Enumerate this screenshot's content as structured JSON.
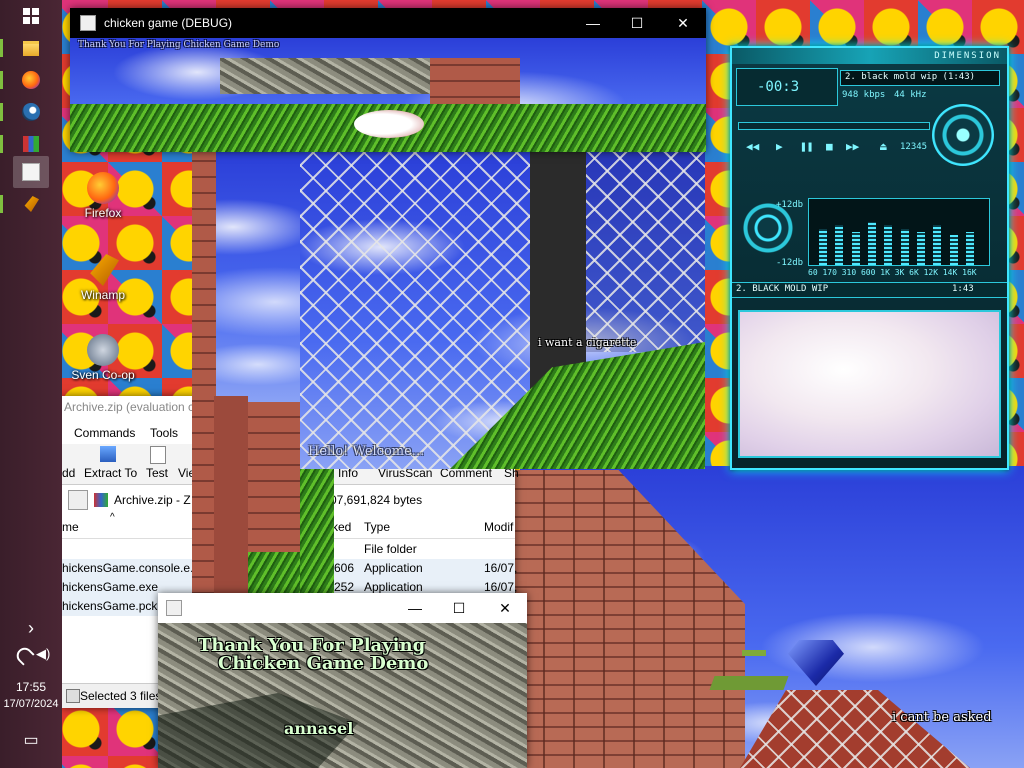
{
  "taskbar": {
    "clock_time": "17:55",
    "clock_date": "17/07/2024",
    "items": [
      {
        "name": "windows-start-icon"
      },
      {
        "name": "file-explorer-icon"
      },
      {
        "name": "firefox-icon"
      },
      {
        "name": "steam-icon"
      },
      {
        "name": "winrar-icon"
      },
      {
        "name": "chicken-game-icon"
      },
      {
        "name": "winamp-icon"
      }
    ],
    "chevron": "›",
    "notification_glyph": "▭"
  },
  "desktop_icons": [
    {
      "label": "Firefox"
    },
    {
      "label": "Winamp"
    },
    {
      "label": "Sven Co-op"
    }
  ],
  "game_window": {
    "title": "chicken game (DEBUG)",
    "minimize": "—",
    "maximize": "☐",
    "close": "✕",
    "hud_text": "Thank You For Playing Chicken Game Demo"
  },
  "small_game_window": {
    "minimize": "—",
    "maximize": "☐",
    "close": "✕",
    "caption_line1": "Thank You For Playing",
    "caption_line2": "Chicken Game Demo",
    "caption_bottom": "annasel"
  },
  "floating_labels": {
    "cigarette": "i want a cigarette",
    "hello": "Hello! Welcome...",
    "cant_be_asked": "i cant be asked"
  },
  "winrar": {
    "title": "Archive.zip (evaluation c",
    "menu": [
      "Commands",
      "Tools"
    ],
    "toolbar": [
      "dd",
      "Extract To",
      "Test",
      "Vie",
      "Info",
      "VirusScan",
      "Comment",
      "Sh"
    ],
    "path": "Archive.zip - Z",
    "archive_size": "07,691,824 bytes",
    "columns": [
      "me",
      "ked",
      "Type",
      "Modif"
    ],
    "rows": [
      {
        "name": "",
        "packed": "",
        "type": "File folder",
        "modified": ""
      },
      {
        "name": "hickensGame.console.e..",
        "packed": "606",
        "type": "Application",
        "modified": "16/07,"
      },
      {
        "name": "hickensGame.exe",
        "packed": "252",
        "type": "Application",
        "modified": "16/07,"
      },
      {
        "name": "hickensGame.pck",
        "packed": "",
        "type": "",
        "modified": ""
      }
    ],
    "status": "Selected 3 files"
  },
  "winamp": {
    "brand": "DIMENSION",
    "time": "-00:3",
    "track": "2. black mold wip (1:43)",
    "bitrate": "948 kbps",
    "samplerate": "44 kHz",
    "eq_plus": "+12db",
    "eq_minus": "-12db",
    "eq_freqs": "60 170 310 600 1K 3K 6K 12K 14K 16K",
    "eq_levels": [
      0.55,
      0.6,
      0.5,
      0.65,
      0.6,
      0.55,
      0.5,
      0.6,
      0.45,
      0.5
    ],
    "playlist_track": "2. BLACK MOLD WIP",
    "playlist_time": "1:43",
    "counter": "12345"
  },
  "colors": {
    "accent_cyan": "#3fe6ff",
    "taskbar": "#3a1e2a",
    "sky_blue": "#2b3fd8",
    "grass_green": "#5fbf2a"
  }
}
